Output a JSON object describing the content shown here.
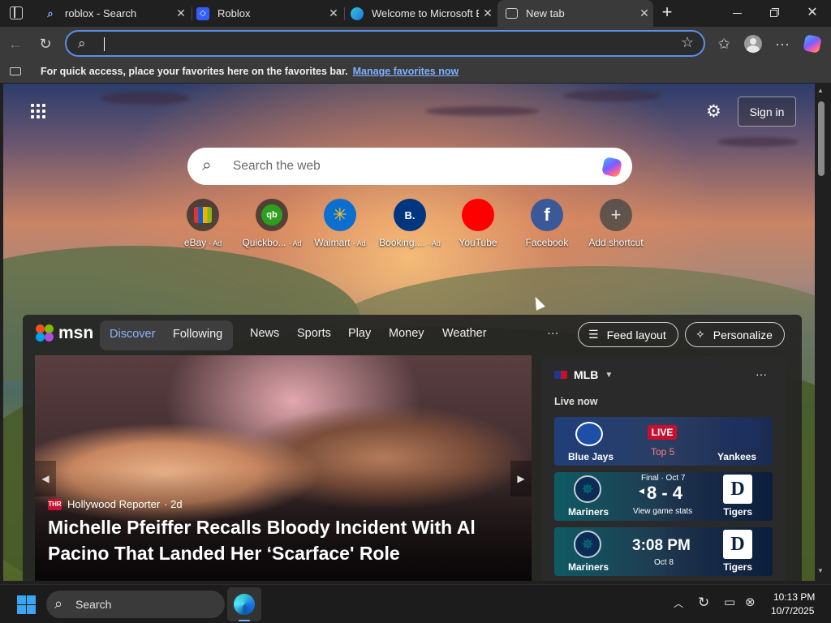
{
  "tabs": [
    {
      "title": "roblox - Search",
      "active": false
    },
    {
      "title": "Roblox",
      "active": false
    },
    {
      "title": "Welcome to Microsoft E",
      "active": false
    },
    {
      "title": "New tab",
      "active": true
    }
  ],
  "favorites_bar": {
    "message": "For quick access, place your favorites here on the favorites bar.",
    "link": "Manage favorites now"
  },
  "header": {
    "sign_in": "Sign in"
  },
  "search": {
    "placeholder": "Search the web"
  },
  "shortcuts": [
    {
      "label": "eBay",
      "ad": "· Ad",
      "icon": "ebay-icon"
    },
    {
      "label": "Quickbo...",
      "ad": "· Ad",
      "icon": "quickbooks-icon"
    },
    {
      "label": "Walmart",
      "ad": "· Ad",
      "icon": "walmart-icon"
    },
    {
      "label": "Booking....",
      "ad": "· Ad",
      "icon": "booking-icon",
      "glyph": "B."
    },
    {
      "label": "YouTube",
      "ad": "",
      "icon": "youtube-icon"
    },
    {
      "label": "Facebook",
      "ad": "",
      "icon": "facebook-icon",
      "glyph": "f"
    },
    {
      "label": "Add shortcut",
      "ad": "",
      "icon": "plus-icon",
      "glyph": "+"
    }
  ],
  "feed": {
    "brand": "msn",
    "discover": "Discover",
    "following": "Following",
    "nav": [
      "News",
      "Sports",
      "Play",
      "Money",
      "Weather"
    ],
    "more": "···",
    "feed_layout": "Feed layout",
    "personalize": "Personalize"
  },
  "hero": {
    "source": "Hollywood Reporter",
    "age": "· 2d",
    "headline": "Michelle Pfeiffer Recalls Bloody Incident With Al Pacino That Landed Her ‘Scarface' Role"
  },
  "mlb": {
    "title": "MLB",
    "more": "···",
    "live_now": "Live now",
    "games": [
      {
        "away": "Blue Jays",
        "home": "Yankees",
        "status": "LIVE",
        "inning": "Top 5"
      },
      {
        "away": "Mariners",
        "home": "Tigers",
        "status": "Final · Oct 7",
        "score": "8 - 4",
        "link": "View game stats"
      },
      {
        "away": "Mariners",
        "home": "Tigers",
        "time": "3:08 PM",
        "date": "Oct 8"
      }
    ]
  },
  "taskbar": {
    "search": "Search",
    "time": "10:13 PM",
    "date": "10/7/2025"
  },
  "colors": {
    "accent": "#5b8fe8",
    "link": "#7fb0ff",
    "live": "#c8102e"
  }
}
